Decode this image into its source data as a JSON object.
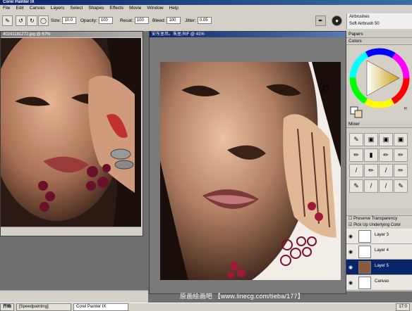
{
  "app": {
    "title": "Corel Painter IX"
  },
  "menu": [
    "File",
    "Edit",
    "Canvas",
    "Layers",
    "Select",
    "Shapes",
    "Effects",
    "Movie",
    "Window",
    "Help"
  ],
  "propbar": {
    "size_label": "Size:",
    "size_value": "10.0",
    "opacity_label": "Opacity:",
    "opacity_value": "100",
    "resat_label": "Resat:",
    "resat_value": "100",
    "bleed_label": "Bleed:",
    "bleed_value": "100",
    "jitter_label": "Jitter:",
    "jitter_value": "0.05"
  },
  "brush": {
    "category": "Airbrushes",
    "variant": "Soft Airbrush 50"
  },
  "docs": {
    "reference_title": "40241181272.jpg @ 67%",
    "painting_title": "安东里昂。朱里.RIF @ 41%"
  },
  "palettes": {
    "papers": "Papers",
    "colors": "Colors",
    "mixer": "Mixer"
  },
  "layers": {
    "preserve": "Preserve Transparency",
    "pickup": "Pick Up Underlying Color",
    "items": [
      "Layer 3",
      "Layer 4",
      "Layer 5",
      "Canvas"
    ]
  },
  "taskbar": {
    "start": "开始",
    "items": [
      "[Speedpainting]",
      "Corel Painter IX"
    ],
    "clock": "17:0"
  },
  "watermark": "原画绘画吧 【www.linecg.com/tieba/177】",
  "colors": {
    "accent": "#0a246a",
    "chrome": "#d4d0c8"
  }
}
